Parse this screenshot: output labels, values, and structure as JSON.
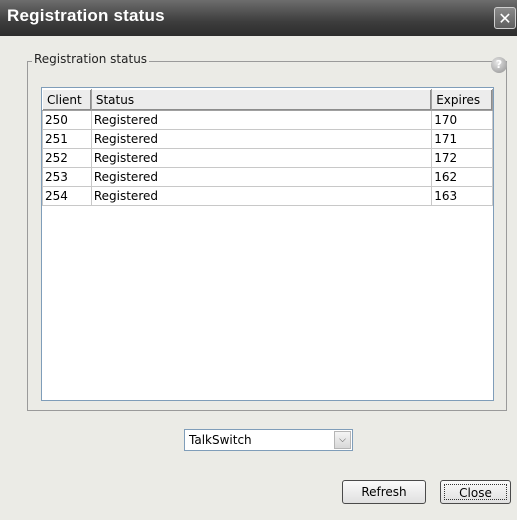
{
  "window": {
    "title": "Registration status",
    "close_glyph": "✕"
  },
  "group": {
    "legend": "Registration status",
    "help_icon": "?"
  },
  "table": {
    "headers": {
      "client": "Client",
      "status": "Status",
      "expires": "Expires"
    },
    "rows": [
      {
        "client": "250",
        "status": "Registered",
        "expires": "170"
      },
      {
        "client": "251",
        "status": "Registered",
        "expires": "171"
      },
      {
        "client": "252",
        "status": "Registered",
        "expires": "172"
      },
      {
        "client": "253",
        "status": "Registered",
        "expires": "162"
      },
      {
        "client": "254",
        "status": "Registered",
        "expires": "163"
      }
    ]
  },
  "selector": {
    "value": "TalkSwitch",
    "arrow": "⌵"
  },
  "buttons": {
    "refresh": "Refresh",
    "close": "Close"
  }
}
